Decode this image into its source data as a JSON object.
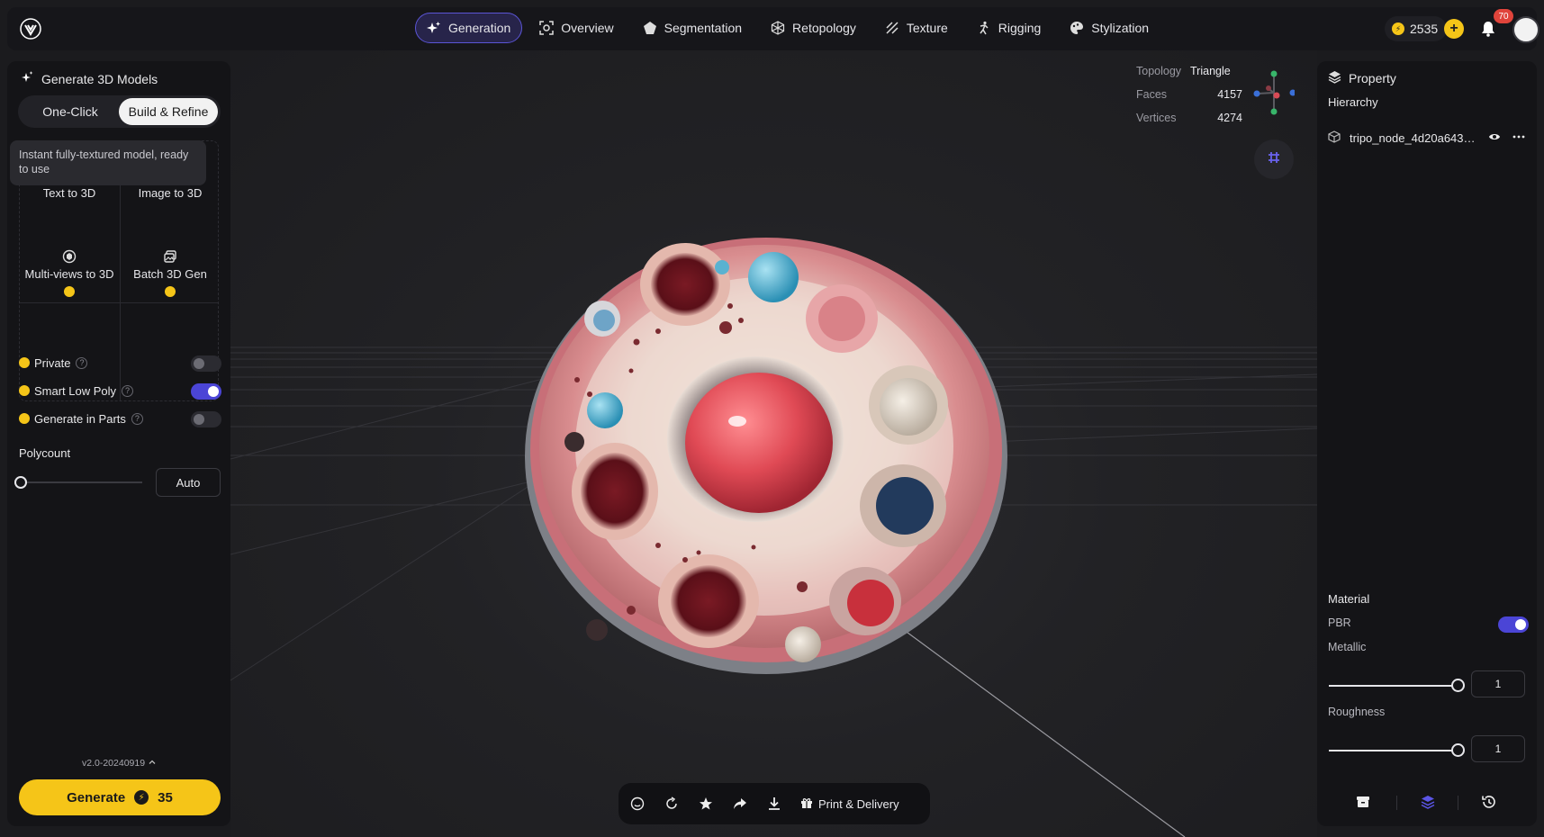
{
  "nav": {
    "tabs": [
      {
        "label": "Generation",
        "icon": "sparkle-icon",
        "active": true
      },
      {
        "label": "Overview",
        "icon": "scan-icon"
      },
      {
        "label": "Segmentation",
        "icon": "segment-icon"
      },
      {
        "label": "Retopology",
        "icon": "mesh-icon"
      },
      {
        "label": "Texture",
        "icon": "texture-icon"
      },
      {
        "label": "Rigging",
        "icon": "figure-icon"
      },
      {
        "label": "Stylization",
        "icon": "palette-icon"
      }
    ],
    "credits": "2535",
    "notifications": "70"
  },
  "left": {
    "title": "Generate 3D Models",
    "seg": {
      "one_click": "One-Click",
      "build_refine": "Build & Refine"
    },
    "tooltip": "Instant fully-textured model, ready to use",
    "modes": {
      "text_to_3d": "Text to 3D",
      "image_to_3d": "Image to 3D",
      "multiview": "Multi-views to 3D",
      "batch": "Batch 3D Gen"
    },
    "options": {
      "private": "Private",
      "smart_low_poly": "Smart Low Poly",
      "generate_in_parts": "Generate in Parts"
    },
    "polycount_label": "Polycount",
    "polycount_value": "Auto",
    "version": "v2.0-20240919",
    "generate": {
      "label": "Generate",
      "cost": "35"
    }
  },
  "viewport": {
    "stats": {
      "topology_label": "Topology",
      "topology_value": "Triangle",
      "faces_label": "Faces",
      "faces_value": "4157",
      "vertices_label": "Vertices",
      "vertices_value": "4274"
    },
    "print_delivery": "Print & Delivery"
  },
  "right": {
    "title": "Property",
    "hierarchy": "Hierarchy",
    "node_name": "tripo_node_4d20a643-3...",
    "material": "Material",
    "pbr": "PBR",
    "metallic_label": "Metallic",
    "metallic_value": "1",
    "roughness_label": "Roughness",
    "roughness_value": "1"
  },
  "colors": {
    "accent": "#4b45d6",
    "brand_yellow": "#f5c518"
  }
}
